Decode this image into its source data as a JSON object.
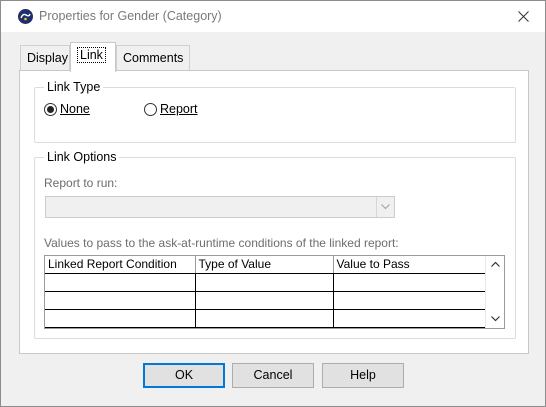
{
  "window": {
    "title": "Properties for Gender (Category)",
    "icon": "app-logo-icon",
    "close_icon": "close-icon"
  },
  "tabs": [
    {
      "label": "Display",
      "active": false
    },
    {
      "label": "Link",
      "active": true
    },
    {
      "label": "Comments",
      "active": false
    }
  ],
  "link_type": {
    "label": "Link Type",
    "options": [
      {
        "label": "None",
        "checked": true
      },
      {
        "label": "Report",
        "checked": false
      }
    ]
  },
  "link_options": {
    "label": "Link Options",
    "report_label": "Report to run:",
    "report_value": "",
    "values_label": "Values to pass to the ask-at-runtime conditions of the linked report:",
    "columns": [
      "Linked Report Condition",
      "Type of Value",
      "Value to Pass"
    ],
    "rows": [
      [
        "",
        "",
        ""
      ],
      [
        "",
        "",
        ""
      ],
      [
        "",
        "",
        ""
      ]
    ]
  },
  "buttons": {
    "ok": "OK",
    "cancel": "Cancel",
    "help": "Help"
  },
  "colors": {
    "accent": "#0078d7",
    "panel": "#ffffff",
    "chrome": "#f0f0f0"
  }
}
